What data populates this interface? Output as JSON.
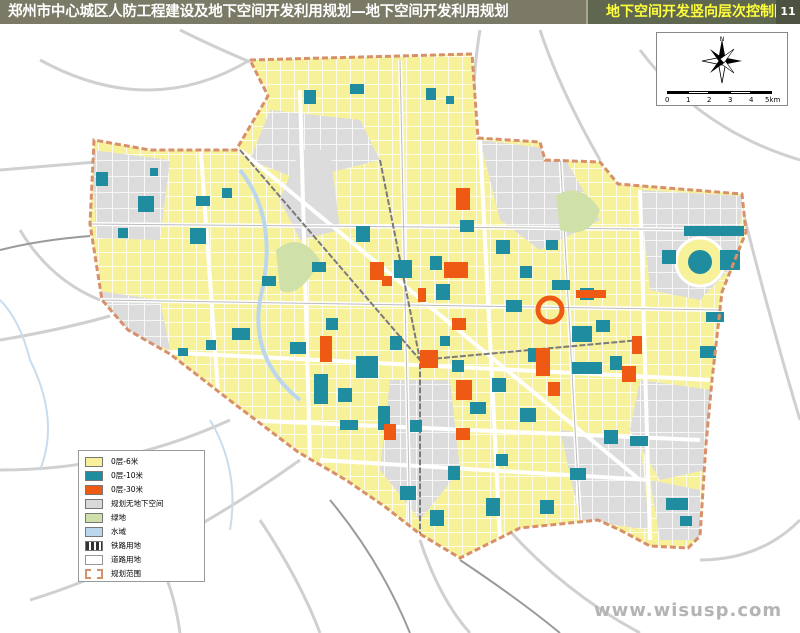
{
  "header": {
    "title": "郑州市中心城区人防工程建设及地下空间开发利用规划—地下空间开发利用规划",
    "subtitle": "地下空间开发竖向层次控制图",
    "page_number": "11"
  },
  "compass": {
    "north_label": "N",
    "scale_labels": [
      "0",
      "1",
      "2",
      "3",
      "4",
      "5km"
    ]
  },
  "legend": {
    "items": [
      {
        "label": "0层-6米",
        "color": "#f7f29a",
        "type": "fill"
      },
      {
        "label": "0层-10米",
        "color": "#1f8ca0",
        "type": "fill"
      },
      {
        "label": "0层-30米",
        "color": "#ee5a14",
        "type": "fill"
      },
      {
        "label": "规划无地下空间",
        "color": "#d9d9d9",
        "type": "fill"
      },
      {
        "label": "绿地",
        "color": "#cfe0a8",
        "type": "fill"
      },
      {
        "label": "水域",
        "color": "#bcd6ee",
        "type": "fill"
      },
      {
        "label": "铁路用地",
        "color": "#444444",
        "type": "rail"
      },
      {
        "label": "道路用地",
        "color": "#ffffff",
        "type": "road"
      },
      {
        "label": "规划范围",
        "color": "#d8906a",
        "type": "boundary"
      }
    ]
  },
  "watermark": "www.wisusp.com",
  "colors": {
    "yellow": "#f7f29a",
    "teal": "#1f8ca0",
    "orange": "#ee5a14",
    "gray": "#d9d9d9",
    "road": "#ffffff",
    "road_outline": "#bcbcbc",
    "boundary": "#d8906a"
  }
}
